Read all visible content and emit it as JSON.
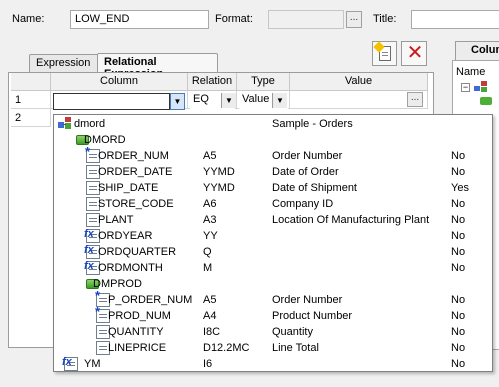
{
  "header": {
    "name_label": "Name:",
    "name_value": "LOW_END",
    "format_label": "Format:",
    "format_value": "",
    "format_btn": "...",
    "title_label": "Title:",
    "title_value": ""
  },
  "tabs": [
    {
      "label": "Expression"
    },
    {
      "label": "Relational Expression"
    }
  ],
  "right_panel": {
    "header": "Colum",
    "tree_header": "Name"
  },
  "grid": {
    "columns": [
      "Column",
      "Relation",
      "Type",
      "Value"
    ],
    "rows": [
      {
        "num": "1",
        "column": "",
        "relation": "EQ",
        "type": "Value",
        "value_btn": "..."
      },
      {
        "num": "2"
      }
    ]
  },
  "dropdown": {
    "items": [
      {
        "name": "dmord",
        "format": "",
        "description": "Sample - Orders",
        "flag": "",
        "icon": "master-file-icon",
        "level": 0
      },
      {
        "name": "DMORD",
        "format": "",
        "description": "",
        "flag": "",
        "icon": "segment-icon",
        "level": 1
      },
      {
        "name": "ORDER_NUM",
        "format": "A5",
        "description": "Order Number",
        "flag": "No",
        "icon": "key-field-icon",
        "level": 2
      },
      {
        "name": "ORDER_DATE",
        "format": "YYMD",
        "description": "Date of Order",
        "flag": "No",
        "icon": "field-icon",
        "level": 2
      },
      {
        "name": "SHIP_DATE",
        "format": "YYMD",
        "description": "Date of Shipment",
        "flag": "Yes",
        "icon": "field-icon",
        "level": 2
      },
      {
        "name": "STORE_CODE",
        "format": "A6",
        "description": "Company ID",
        "flag": "No",
        "icon": "field-icon",
        "level": 2
      },
      {
        "name": "PLANT",
        "format": "A3",
        "description": "Location Of Manufacturing Plant",
        "flag": "No",
        "icon": "field-icon",
        "level": 2
      },
      {
        "name": "ORDYEAR",
        "format": "YY",
        "description": "",
        "flag": "No",
        "icon": "define-field-icon",
        "level": 2
      },
      {
        "name": "ORDQUARTER",
        "format": "Q",
        "description": "",
        "flag": "No",
        "icon": "define-field-icon",
        "level": 2
      },
      {
        "name": "ORDMONTH",
        "format": "M",
        "description": "",
        "flag": "No",
        "icon": "define-field-icon",
        "level": 2
      },
      {
        "name": "DMPROD",
        "format": "",
        "description": "",
        "flag": "",
        "icon": "segment-icon",
        "level": 2
      },
      {
        "name": "P_ORDER_NUM",
        "format": "A5",
        "description": "Order Number",
        "flag": "No",
        "icon": "key-field-icon",
        "level": 3
      },
      {
        "name": "PROD_NUM",
        "format": "A4",
        "description": "Product Number",
        "flag": "No",
        "icon": "key-field-icon",
        "level": 3
      },
      {
        "name": "QUANTITY",
        "format": "I8C",
        "description": "Quantity",
        "flag": "No",
        "icon": "field-icon",
        "level": 3
      },
      {
        "name": "LINEPRICE",
        "format": "D12.2MC",
        "description": "Line Total",
        "flag": "No",
        "icon": "field-icon",
        "level": 3
      },
      {
        "name": "YM",
        "format": "I6",
        "description": "",
        "flag": "No",
        "icon": "define-field-icon",
        "level": 0
      }
    ]
  },
  "colors": {
    "close_red": "#cc1a1a",
    "icon_blue": "#1a46c8",
    "segment_green": "#4fae35"
  }
}
